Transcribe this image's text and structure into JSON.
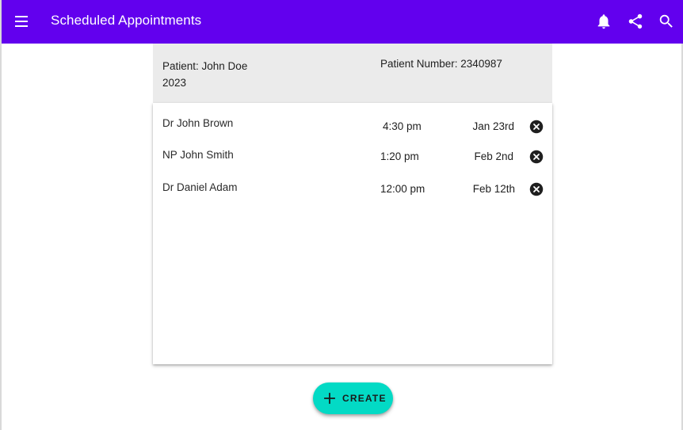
{
  "appbar": {
    "title": "Scheduled Appointments",
    "color": "#6200ee",
    "icons": [
      "menu-icon",
      "bell-icon",
      "share-icon",
      "search-icon"
    ]
  },
  "patient": {
    "name_line": "Patient: John Doe",
    "year": "2023",
    "number_line": "Patient Number: 2340987"
  },
  "appointments": [
    {
      "provider": "Dr John Brown",
      "time": "4:30 pm",
      "date": "Jan 23rd"
    },
    {
      "provider": "NP John Smith",
      "time": "1:20 pm",
      "date": "Feb 2nd"
    },
    {
      "provider": "Dr Daniel Adam",
      "time": "12:00 pm",
      "date": "Feb 12th"
    }
  ],
  "fab": {
    "label": "CREATE",
    "color": "#03dac5",
    "icon": "plus-icon"
  }
}
